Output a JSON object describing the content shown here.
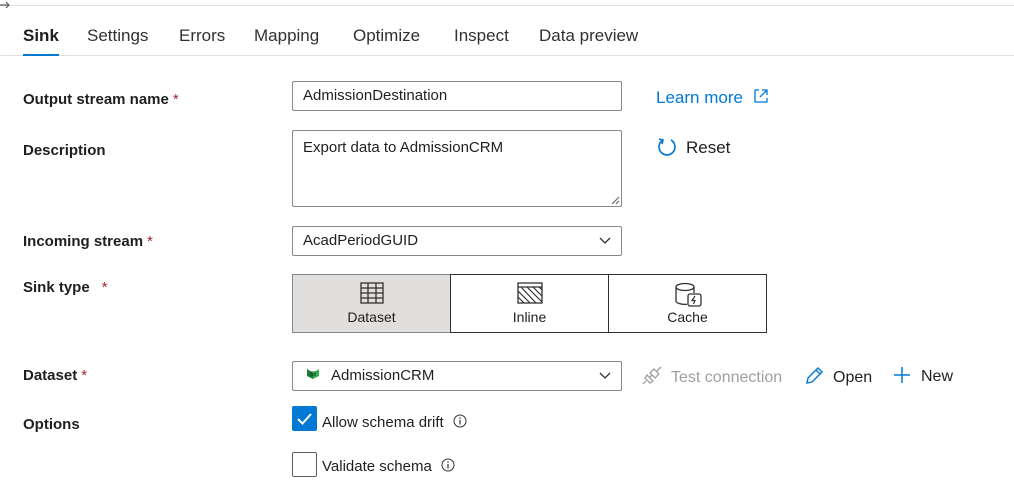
{
  "tabs": [
    {
      "label": "Sink",
      "active": true
    },
    {
      "label": "Settings"
    },
    {
      "label": "Errors"
    },
    {
      "label": "Mapping"
    },
    {
      "label": "Optimize"
    },
    {
      "label": "Inspect"
    },
    {
      "label": "Data preview"
    }
  ],
  "form": {
    "output_stream_name": {
      "label": "Output stream name",
      "required_mark": "*",
      "value": "AdmissionDestination"
    },
    "description": {
      "label": "Description",
      "value": "Export data to AdmissionCRM"
    },
    "incoming_stream": {
      "label": "Incoming stream",
      "required_mark": "*",
      "value": "AcadPeriodGUID"
    },
    "sink_type": {
      "label": "Sink type",
      "required_mark": "*",
      "options": [
        {
          "label": "Dataset",
          "icon": "table-icon",
          "selected": true
        },
        {
          "label": "Inline",
          "icon": "inline-icon"
        },
        {
          "label": "Cache",
          "icon": "cache-icon"
        }
      ]
    },
    "dataset": {
      "label": "Dataset",
      "required_mark": "*",
      "value": "AdmissionCRM",
      "icon": "dynamics-crm-icon"
    },
    "options": {
      "label": "Options",
      "allow_schema_drift": {
        "label": "Allow schema drift",
        "checked": true
      },
      "validate_schema": {
        "label": "Validate schema",
        "checked": false
      }
    }
  },
  "actions": {
    "learn_more": "Learn more",
    "reset": "Reset",
    "test_connection": "Test connection",
    "open": "Open",
    "new": "New"
  },
  "colors": {
    "accent": "#0078d4",
    "required": "#a4262c",
    "disabled": "#a19f9d"
  }
}
